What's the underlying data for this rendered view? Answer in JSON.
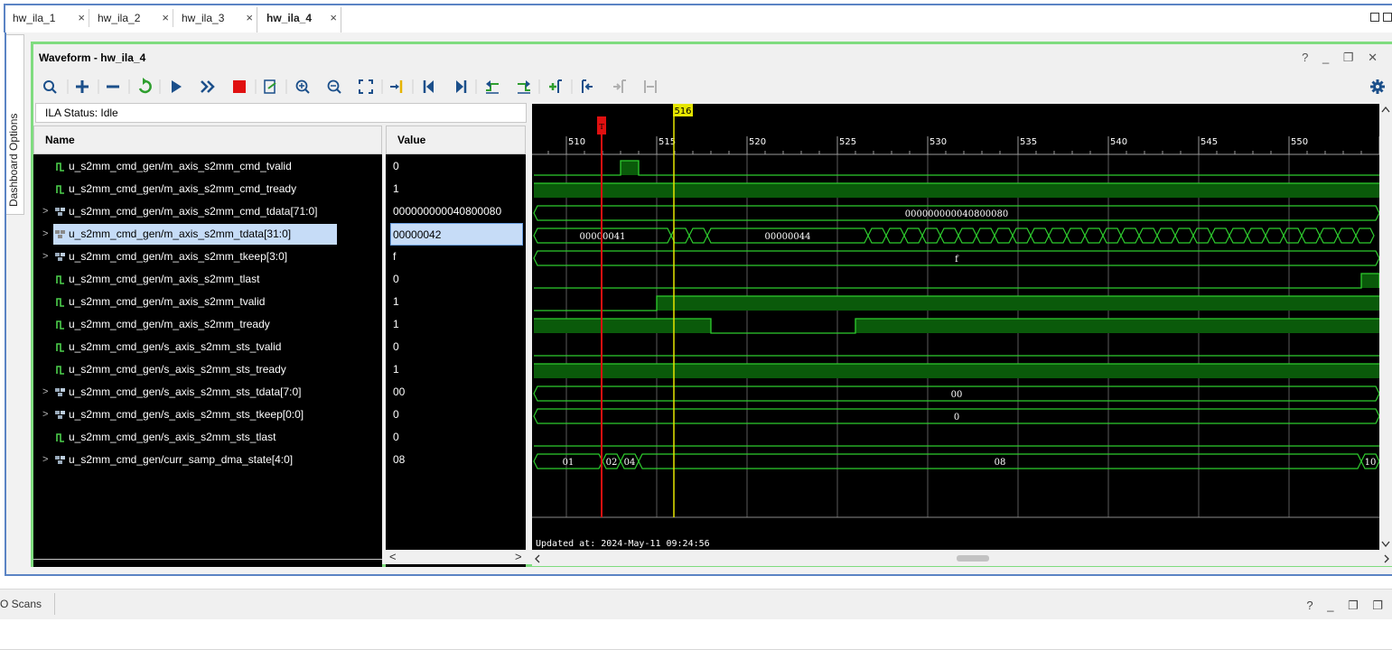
{
  "tabs": [
    {
      "label": "hw_ila_1",
      "close": "×",
      "active": false
    },
    {
      "label": "hw_ila_2",
      "close": "×",
      "active": false
    },
    {
      "label": "hw_ila_3",
      "close": "×",
      "active": false
    },
    {
      "label": "hw_ila_4",
      "close": "×",
      "active": true
    }
  ],
  "side_tab": {
    "label": "Dashboard Options"
  },
  "panel": {
    "title": "Waveform - hw_ila_4",
    "controls": "? _ ❐ ✕"
  },
  "toolbar": {
    "icons": [
      "search-icon",
      "add-icon",
      "remove-icon",
      "refresh-icon",
      "run-trigger-icon",
      "run-immediate-icon",
      "stop-icon",
      "export-icon",
      "zoom-in-icon",
      "zoom-out-icon",
      "zoom-fit-icon",
      "go-to-cursor-icon",
      "go-to-time-zero-icon",
      "go-to-last-time-icon",
      "previous-transition-icon",
      "next-transition-icon",
      "add-marker-icon",
      "previous-marker-icon",
      "next-marker-icon",
      "swap-cursors-icon",
      "settings-icon"
    ]
  },
  "ila_status": "ILA Status: Idle",
  "columns": {
    "name": "Name",
    "value": "Value"
  },
  "signals": [
    {
      "name": "u_s2mm_cmd_gen/m_axis_s2mm_cmd_tvalid",
      "value": "0",
      "bus": false,
      "expandable": false
    },
    {
      "name": "u_s2mm_cmd_gen/m_axis_s2mm_cmd_tready",
      "value": "1",
      "bus": false,
      "expandable": false
    },
    {
      "name": "u_s2mm_cmd_gen/m_axis_s2mm_cmd_tdata[71:0]",
      "value": "000000000040800080",
      "bus": true,
      "expandable": true
    },
    {
      "name": "u_s2mm_cmd_gen/m_axis_s2mm_tdata[31:0]",
      "value": "00000042",
      "bus": true,
      "expandable": true,
      "selected": true
    },
    {
      "name": "u_s2mm_cmd_gen/m_axis_s2mm_tkeep[3:0]",
      "value": "f",
      "bus": true,
      "expandable": true
    },
    {
      "name": "u_s2mm_cmd_gen/m_axis_s2mm_tlast",
      "value": "0",
      "bus": false,
      "expandable": false
    },
    {
      "name": "u_s2mm_cmd_gen/m_axis_s2mm_tvalid",
      "value": "1",
      "bus": false,
      "expandable": false
    },
    {
      "name": "u_s2mm_cmd_gen/m_axis_s2mm_tready",
      "value": "1",
      "bus": false,
      "expandable": false
    },
    {
      "name": "u_s2mm_cmd_gen/s_axis_s2mm_sts_tvalid",
      "value": "0",
      "bus": false,
      "expandable": false
    },
    {
      "name": "u_s2mm_cmd_gen/s_axis_s2mm_sts_tready",
      "value": "1",
      "bus": false,
      "expandable": false
    },
    {
      "name": "u_s2mm_cmd_gen/s_axis_s2mm_sts_tdata[7:0]",
      "value": "00",
      "bus": true,
      "expandable": true
    },
    {
      "name": "u_s2mm_cmd_gen/s_axis_s2mm_sts_tkeep[0:0]",
      "value": "0",
      "bus": true,
      "expandable": true
    },
    {
      "name": "u_s2mm_cmd_gen/s_axis_s2mm_sts_tlast",
      "value": "0",
      "bus": false,
      "expandable": false
    },
    {
      "name": "u_s2mm_cmd_gen/curr_samp_dma_state[4:0]",
      "value": "08",
      "bus": true,
      "expandable": true
    }
  ],
  "timeline": {
    "ticks": [
      "510",
      "515",
      "520",
      "525",
      "530",
      "535",
      "540",
      "545",
      "550"
    ],
    "cursor_label": "516",
    "trigger_label": "T"
  },
  "bus_labels": {
    "cmd_tdata": "000000000040800080",
    "tdata_a": "00000041",
    "tdata_b": "00000044",
    "tkeep": "f",
    "sts_tdata": "00",
    "sts_tkeep": "0",
    "state_01": "01",
    "state_02": "02",
    "state_04": "04",
    "state_08": "08",
    "state_10": "10"
  },
  "updated_at": "Updated at: 2024-May-11 09:24:56",
  "bottom": {
    "scans_label": "O Scans",
    "controls": "? _ ❐ ❐"
  },
  "colors": {
    "wave_green": "#2ecc2e",
    "wave_fill": "#0a5a0a",
    "trigger_red": "#e01010",
    "cursor_yellow": "#e6e600",
    "panel_border": "#7fdc7f",
    "frame_blue": "#5b84c4"
  }
}
